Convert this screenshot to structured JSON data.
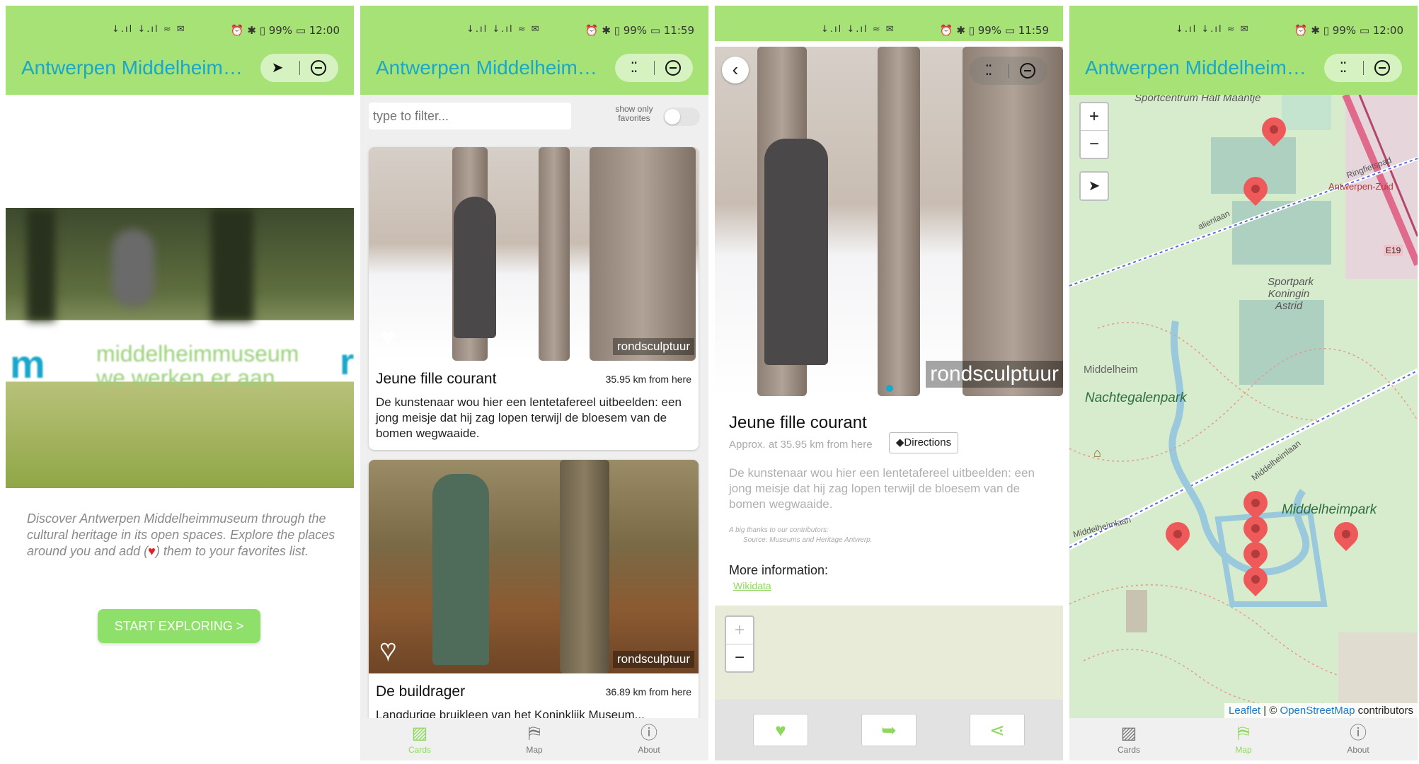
{
  "app_title": "Antwerpen Middelheim…",
  "status": {
    "signal": "↓.ıl ↓.ıl ≈ ✉",
    "s1_right": "⏰ ✱ ▯ 99% ▭ 12:00",
    "s2_right": "⏰ ✱ ▯ 99% ▭ 11:59",
    "s3_right": "⏰ ✱ ▯ 99% ▭ 11:59",
    "s4_right": "⏰ ✱ ▯ 99% ▭ 12:00"
  },
  "welcome": {
    "hero_text_1": "middelheimmuseum",
    "hero_text_2": "we werken er aan",
    "hero_logo": "m",
    "intro_before": "Discover Antwerpen Middelheimmuseum through the cultural heritage in its open spaces. Explore the places around you and add (",
    "intro_heart": "♥",
    "intro_after": ") them to your favorites list.",
    "start_button": "START EXPLORING >"
  },
  "list": {
    "filter_placeholder": "type to filter...",
    "show_favorites_label": "show only favorites",
    "cards": [
      {
        "title": "Jeune fille courant",
        "distance": "35.95 km from here",
        "description": "De kunstenaar wou hier een lentetafereel uitbeelden: een jong meisje dat hij zag lopen terwijl de bloesem van de bomen wegwaaide.",
        "credit": "rondsculptuur"
      },
      {
        "title": "De buildrager",
        "distance": "36.89 km from here",
        "description": "Langdurige bruikleen van het Koninklijk Museum...",
        "credit": "rondsculptuur"
      }
    ]
  },
  "nav": {
    "cards": "Cards",
    "map": "Map",
    "about": "About"
  },
  "detail": {
    "credit": "rondsculptuur",
    "title": "Jeune fille courant",
    "approx": "Approx. at 35.95 km from here",
    "directions": "Directions",
    "description": "De kunstenaar wou hier een lentetafereel uitbeelden: een jong meisje dat hij zag lopen terwijl de bloesem van de bomen wegwaaide.",
    "thanks": "A big thanks to our contributors:",
    "source": "Source: Museums and Heritage Antwerp.",
    "more_info": "More information:",
    "wikidata": "Wikidata"
  },
  "map": {
    "zoom_in": "+",
    "zoom_out": "−",
    "labels": {
      "sportcentrum": "Sportcentrum Half Maantje",
      "sportpark": "Sportpark Koningin Astrid",
      "middelheim": "Middelheim",
      "nachtegalenpark": "Nachtegalenpark",
      "middelheimpark": "Middelheimpark",
      "antwerpen_zuid": "Antwerpen-Zuid",
      "e19": "E19",
      "ringfietspad": "Ringfietspad",
      "middelheimlaan": "Middelheimlaan",
      "italienlaan": "alienlaan",
      "middelheimlaan_left": "Middelheimlaan"
    },
    "attribution_leaflet": "Leaflet",
    "attribution_sep": " | © ",
    "attribution_osm": "OpenStreetMap",
    "attribution_rest": " contributors"
  },
  "colors": {
    "appbar": "#a6e276",
    "title": "#1aa7c9",
    "accent": "#8fd85e",
    "pin": "#ee5a5a"
  }
}
